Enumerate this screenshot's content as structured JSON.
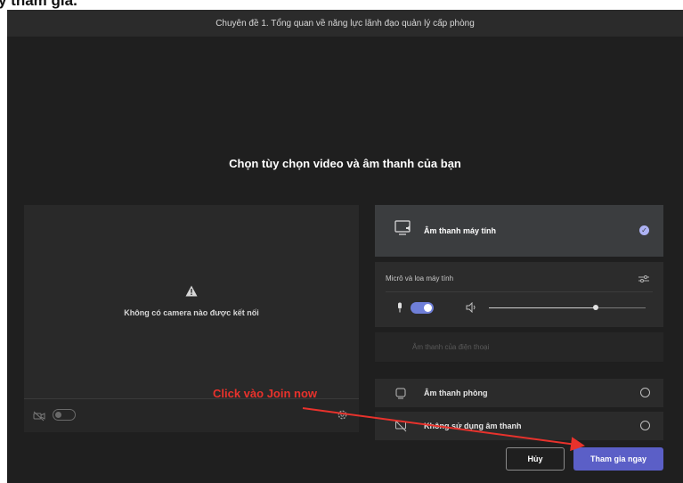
{
  "document": {
    "heading": "y tham gia."
  },
  "window": {
    "title": "Chuyên đề 1. Tổng quan về năng lực lãnh đạo quản lý cấp phòng"
  },
  "main": {
    "title": "Chọn tùy chọn video và âm thanh của bạn"
  },
  "preview": {
    "no_camera_text": "Không có camera nào được kết nối",
    "camera_toggle_on": false
  },
  "audio": {
    "computer_audio_label": "Âm thanh máy tính",
    "device_label": "Micrô và loa máy tính",
    "mic_on": true,
    "volume_level": 0.68,
    "phone_audio_label": "Âm thanh của điện thoại",
    "room_audio_label": "Âm thanh phòng",
    "no_audio_label": "Không sử dụng âm thanh"
  },
  "actions": {
    "cancel_label": "Hủy",
    "join_label": "Tham gia ngay"
  },
  "annotation": {
    "text": "Click vào Join now",
    "color": "#e8322c"
  },
  "colors": {
    "accent": "#5b5fc7",
    "background": "#1f1f1f"
  }
}
